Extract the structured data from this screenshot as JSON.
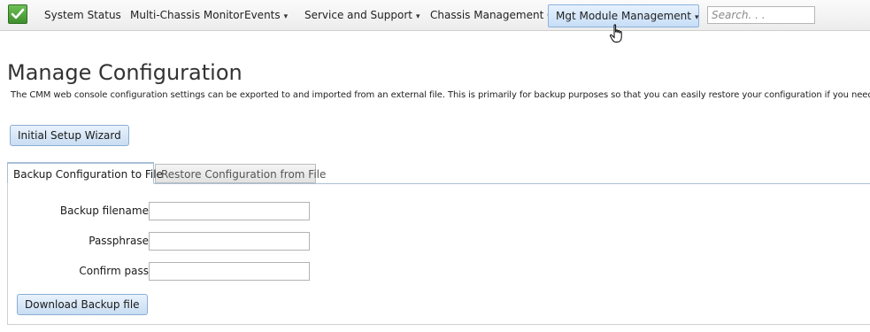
{
  "nav": {
    "items": [
      {
        "label": "System Status",
        "dropdown": false
      },
      {
        "label": "Multi-Chassis Monitor",
        "dropdown": false
      },
      {
        "label": "Events",
        "dropdown": true
      },
      {
        "label": "Service and Support",
        "dropdown": true
      },
      {
        "label": "Chassis Management",
        "dropdown": true
      },
      {
        "label": "Mgt Module Management",
        "dropdown": true,
        "active": true
      }
    ],
    "caret": "▾",
    "search_placeholder": "Search. . .",
    "status_icon": "check-icon"
  },
  "page": {
    "title": "Manage Configuration",
    "description": "The CMM web console configuration settings can be exported to and imported from an external file. This is primarily for backup purposes so that you can easily restore your configuration if you need to.",
    "wizard_button": "Initial Setup Wizard"
  },
  "tabs": {
    "active": "Backup Configuration to File",
    "inactive": "Restore Configuration from File"
  },
  "form": {
    "backup_filename_label": "Backup filename:",
    "passphrase_label": "Passphrase:",
    "confirm_label": "Confirm pass:",
    "backup_filename_value": "",
    "passphrase_value": "",
    "confirm_value": "",
    "download_button": "Download Backup file"
  },
  "colors": {
    "accent": "#c7def7",
    "status_green": "#4fa33a"
  }
}
